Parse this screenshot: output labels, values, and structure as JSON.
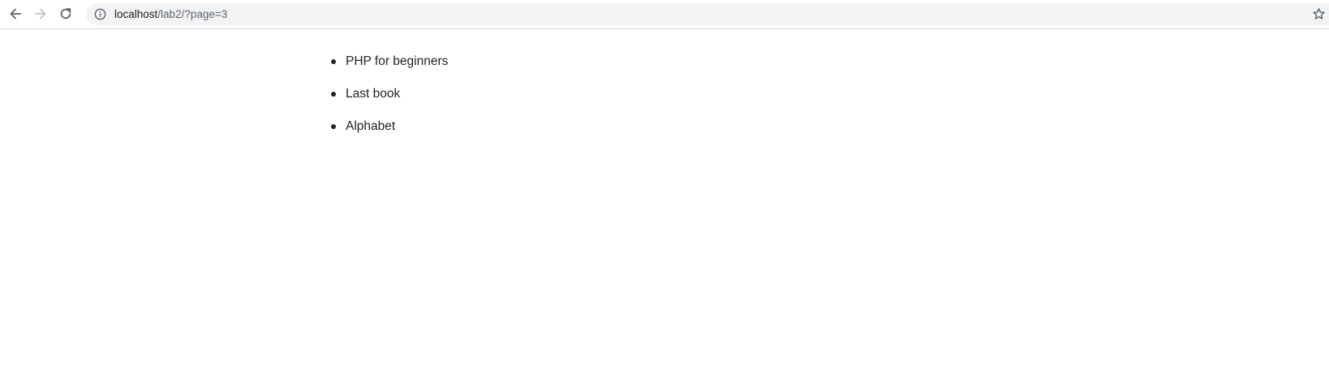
{
  "browser": {
    "url_host": "localhost",
    "url_path": "/lab2/?page=3",
    "icons": {
      "back": "arrow-left-icon",
      "forward": "arrow-right-icon",
      "reload": "reload-icon",
      "site_info": "info-icon",
      "bookmark": "star-icon"
    },
    "forward_enabled": false
  },
  "books": [
    "PHP for beginners",
    "Last book",
    "Alphabet"
  ]
}
